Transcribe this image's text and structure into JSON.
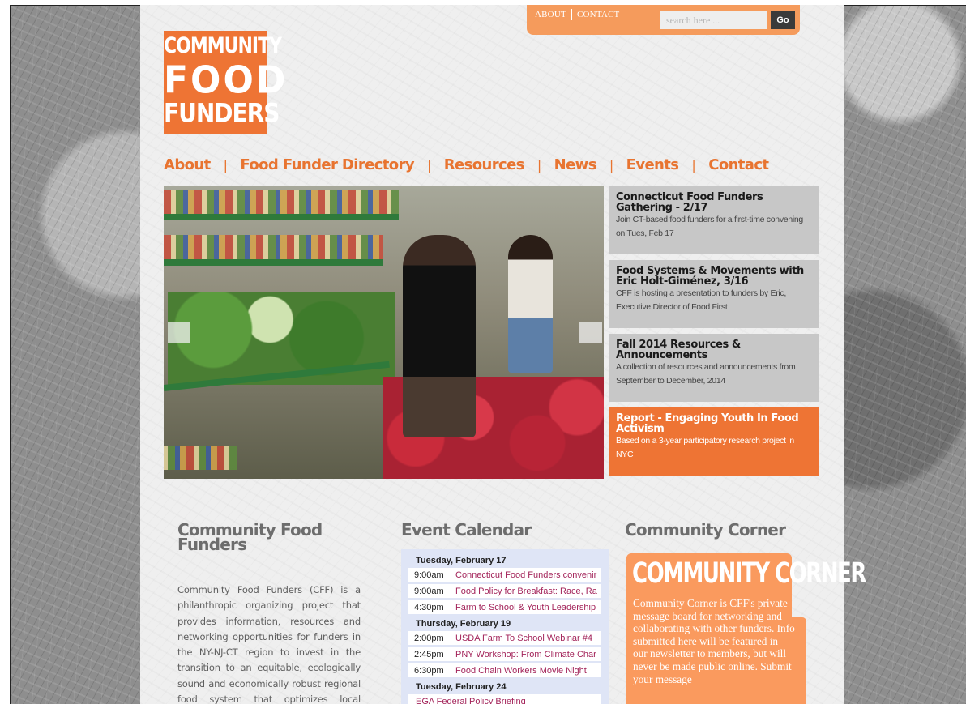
{
  "utility": {
    "about": "ABOUT",
    "contact": "CONTACT",
    "search_placeholder": "search here ...",
    "go": "Go"
  },
  "logo": {
    "line1": "COMMUNITY",
    "line2": "FOOD",
    "line3": "FUNDERS"
  },
  "nav": {
    "items": [
      "About",
      "Food Funder Directory",
      "Resources",
      "News",
      "Events",
      "Contact"
    ],
    "separator": "|"
  },
  "features": [
    {
      "title": "Connecticut Food Funders Gathering - 2/17",
      "desc": "Join CT-based food funders for a first-time convening on Tues, Feb 17"
    },
    {
      "title": "Food Systems & Movements with Eric Holt-Giménez, 3/16",
      "desc": "CFF is hosting a presentation to funders by Eric, Executive Director of Food First"
    },
    {
      "title": "Fall 2014 Resources & Announcements",
      "desc": "A collection of resources and announcements from September to December, 2014"
    },
    {
      "title": "Report - Engaging Youth In Food Activism",
      "desc": "Based on a 3-year participatory research project in NYC"
    }
  ],
  "about": {
    "heading": "Community Food Funders",
    "text": "Community Food Funders (CFF) is a philanthropic organizing project that provides information, resources and networking opportunities for funders in the NY-NJ-CT region to invest in the transition to an equitable, ecologically sound and economically robust regional food system that optimizes local growing,"
  },
  "calendar": {
    "heading": "Event Calendar",
    "days": [
      {
        "label": "Tuesday, February 17",
        "events": [
          {
            "time": "9:00am",
            "title": "Connecticut Food Funders convenir"
          },
          {
            "time": "9:00am",
            "title": "Food Policy for Breakfast: Race, Ra"
          },
          {
            "time": "4:30pm",
            "title": "Farm to School & Youth Leadership"
          }
        ]
      },
      {
        "label": "Thursday, February 19",
        "events": [
          {
            "time": "2:00pm",
            "title": "USDA Farm To School Webinar #4"
          },
          {
            "time": "2:45pm",
            "title": "PNY Workshop: From Climate Char"
          },
          {
            "time": "6:30pm",
            "title": "Food Chain Workers Movie Night"
          }
        ]
      },
      {
        "label": "Tuesday, February 24",
        "events": [
          {
            "time": "",
            "title": "EGA Federal Policy Briefing"
          }
        ]
      }
    ]
  },
  "community": {
    "heading": "Community Corner",
    "card_title": "COMMUNITY CORNER",
    "text": "Community Corner is CFF's private message board for networking and collaborating with other funders. Info submitted here will be featured in our newsletter to members, but will never be made public online. Submit your message"
  },
  "colors": {
    "accent": "#ee7434",
    "utility_bar": "#f59b5c",
    "feature_bg": "#c7c7c7",
    "calendar_bg": "#dfe5f6",
    "event_link": "#a3245a"
  }
}
